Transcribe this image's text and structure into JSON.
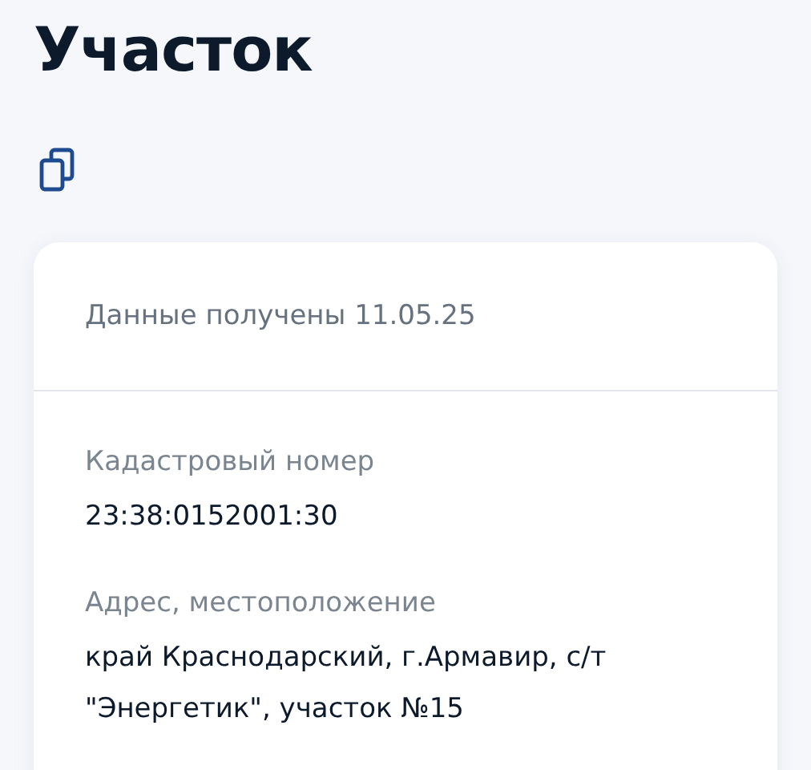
{
  "title": "Участок",
  "card": {
    "header": "Данные получены 11.05.25",
    "fields": [
      {
        "label": "Кадастровый номер",
        "value": "23:38:0152001:30"
      },
      {
        "label": "Адрес, местоположение",
        "value": "край Краснодарский, г.Армавир, с/т \"Энергетик\", участок №15"
      }
    ]
  }
}
